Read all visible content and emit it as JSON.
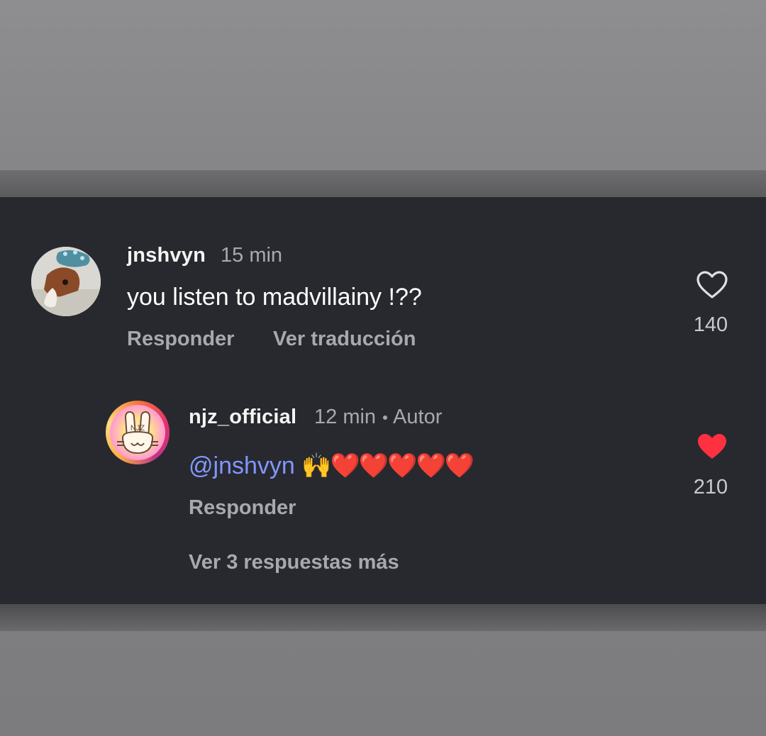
{
  "comments": [
    {
      "username": "jnshvyn",
      "time": "15 min",
      "text": "you listen to madvillainy !??",
      "actions": {
        "reply": "Responder",
        "translate": "Ver traducción"
      },
      "likes": "140",
      "liked": false
    }
  ],
  "reply": {
    "username": "njz_official",
    "time": "12 min",
    "author_badge": "Autor",
    "mention": "@jnshvyn",
    "emoji": "🙌❤️❤️❤️❤️❤️",
    "actions": {
      "reply": "Responder"
    },
    "likes": "210",
    "liked": true,
    "avatar_text": "NJZ"
  },
  "more_replies": "Ver 3 respuestas más",
  "colors": {
    "panel": "#27292e",
    "mention": "#8296ff",
    "like_active": "#ff3040",
    "secondary_text": "#a7a9ae"
  }
}
